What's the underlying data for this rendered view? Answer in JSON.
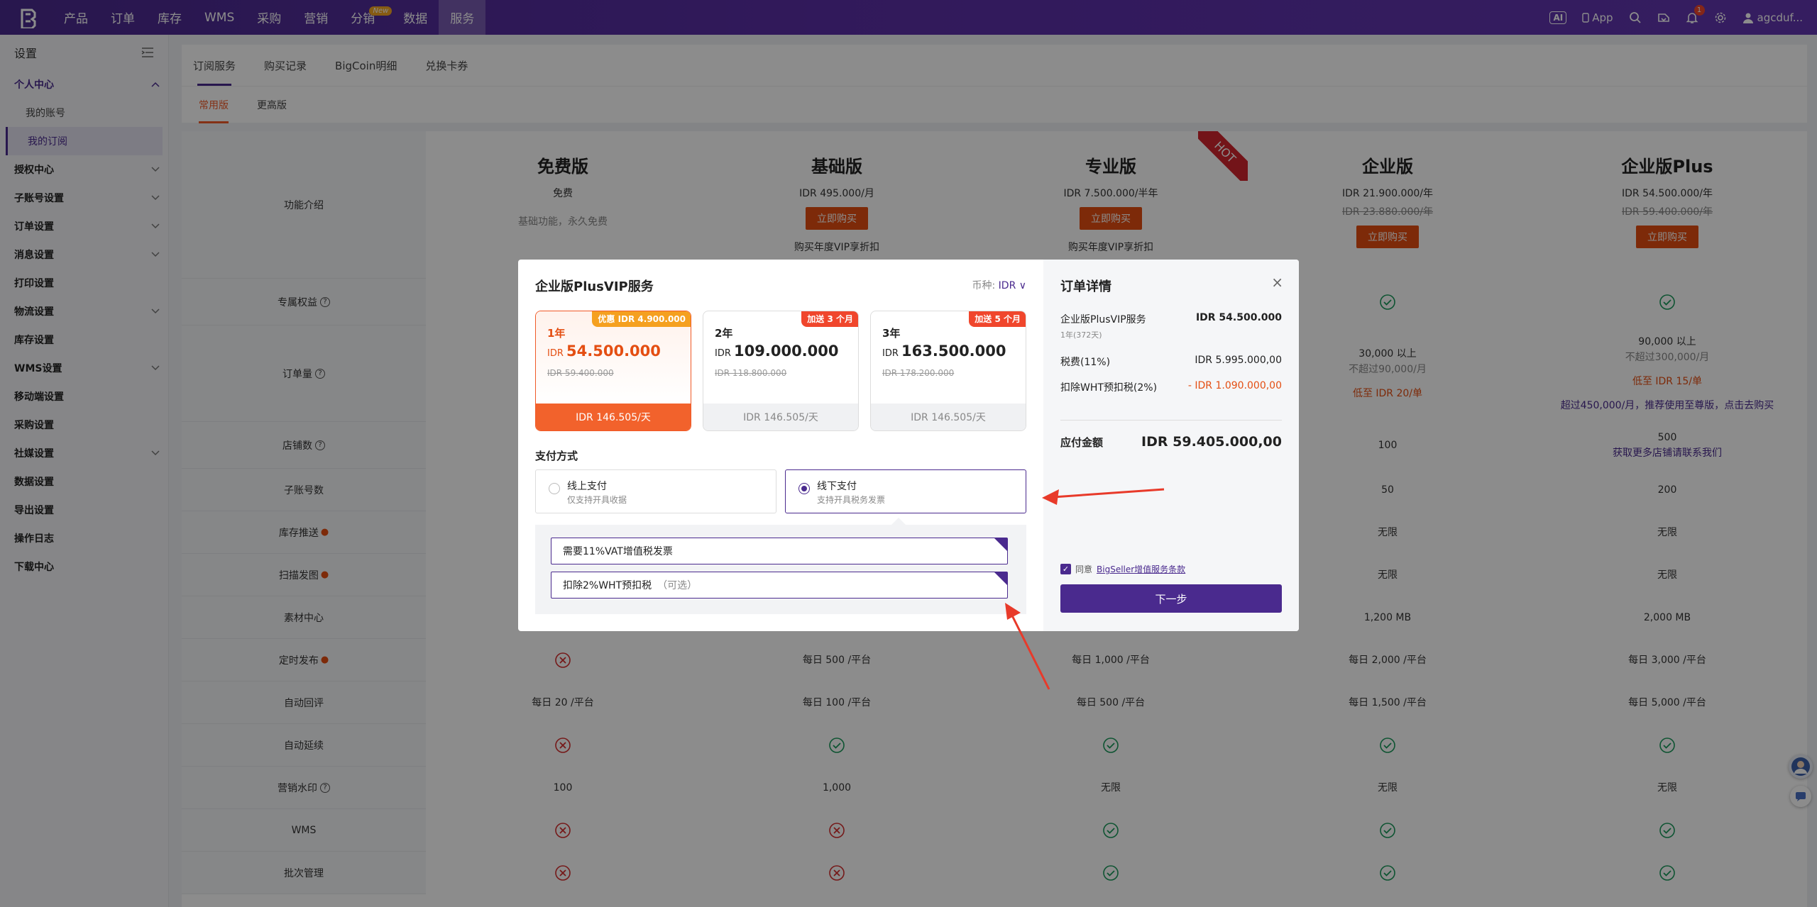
{
  "nav": {
    "items": [
      "产品",
      "订单",
      "库存",
      "WMS",
      "采购",
      "营销",
      "分销",
      "数据",
      "服务"
    ],
    "new_badge": "New",
    "ai": "AI",
    "app": "App",
    "notify_count": "1",
    "user": "agcduf..."
  },
  "sidebar": {
    "title": "设置",
    "groups": [
      {
        "label": "个人中心",
        "open": true
      },
      {
        "label": "授权中心"
      },
      {
        "label": "子账号设置"
      },
      {
        "label": "订单设置"
      },
      {
        "label": "消息设置"
      },
      {
        "label": "打印设置"
      },
      {
        "label": "物流设置"
      },
      {
        "label": "库存设置"
      },
      {
        "label": "WMS设置"
      },
      {
        "label": "移动端设置"
      },
      {
        "label": "采购设置"
      },
      {
        "label": "社媒设置"
      },
      {
        "label": "数据设置"
      },
      {
        "label": "导出设置"
      },
      {
        "label": "操作日志"
      },
      {
        "label": "下载中心"
      }
    ],
    "sub": [
      "我的账号",
      "我的订阅"
    ]
  },
  "tabs": [
    "订阅服务",
    "购买记录",
    "BigCoin明细",
    "兑换卡券"
  ],
  "subtabs": [
    "常用版",
    "更高版"
  ],
  "plans": [
    {
      "name": "免费版",
      "price": "免费",
      "desc": "基础功能，永久免费"
    },
    {
      "name": "基础版",
      "price": "IDR 495.000/月",
      "buy": "立即购买",
      "vip": "购买年度VIP享折扣"
    },
    {
      "name": "专业版",
      "price": "IDR 7.500.000/半年",
      "buy": "立即购买",
      "vip": "购买年度VIP享折扣",
      "hot": "HOT"
    },
    {
      "name": "企业版",
      "price": "IDR 21.900.000/年",
      "orig": "IDR 23.880.000/年",
      "buy": "立即购买"
    },
    {
      "name": "企业版Plus",
      "price": "IDR 54.500.000/年",
      "orig": "IDR 59.400.000/年",
      "buy": "立即购买"
    }
  ],
  "features": {
    "intro": "功能介绍",
    "exclusive": "专属权益",
    "orders": "订单量",
    "shops": "店铺数",
    "subaccounts": "子账号数",
    "stock_push": "库存推送",
    "scan_ship": "扫描发图",
    "material": "素材中心",
    "schedule": "定时发布",
    "auto_reply": "自动回评",
    "auto_extend": "自动延续",
    "watermark": "营销水印",
    "wms": "WMS",
    "batch": "批次管理"
  },
  "rows": {
    "orders_ent": [
      "30,000 以上",
      "不超过90,000/月",
      "低至 IDR 20/单"
    ],
    "orders_plus": [
      "90,000 以上",
      "不超过300,000/月",
      "低至 IDR 15/单",
      "超过450,000/月，推荐使用至尊版，点击去购买"
    ],
    "shops_ent": "100",
    "shops_plus": "500",
    "shops_plus_link": "获取更多店铺请联系我们",
    "sub_ent": "50",
    "sub_plus": "200",
    "unlimited": "无限",
    "material_ent": "1,200 MB",
    "material_plus": "2,000 MB",
    "schedule": [
      "每日 500 /平台",
      "每日 1,000 /平台",
      "每日 2,000 /平台",
      "每日 3,000 /平台"
    ],
    "reply": [
      "每日 20 /平台",
      "每日 100 /平台",
      "每日 500 /平台",
      "每日 1,500 /平台",
      "每日 5,000 /平台"
    ],
    "watermark": [
      "100",
      "1,000",
      "无限",
      "无限",
      "无限"
    ]
  },
  "modal": {
    "title": "企业版PlusVIP服务",
    "currency_label": "币种:",
    "currency": "IDR",
    "options": [
      {
        "years": "1年",
        "cur": "IDR",
        "amount": "54.500.000",
        "old": "IDR 59.400.000",
        "perday": "IDR 146.505/天",
        "ribbon": "优惠 IDR 4.900.000"
      },
      {
        "years": "2年",
        "cur": "IDR",
        "amount": "109.000.000",
        "old": "IDR 118.800.000",
        "perday": "IDR 146.505/天",
        "ribbon": "加送 3 个月"
      },
      {
        "years": "3年",
        "cur": "IDR",
        "amount": "163.500.000",
        "old": "IDR 178.200.000",
        "perday": "IDR 146.505/天",
        "ribbon": "加送 5 个月"
      }
    ],
    "pay_label": "支付方式",
    "pay_online": "线上支付",
    "pay_online_sub": "仅支持开具收据",
    "pay_offline": "线下支付",
    "pay_offline_sub": "支持开具税务发票",
    "vat": "需要11%VAT增值税发票",
    "wht": "扣除2%WHT预扣税",
    "optional": "（可选）"
  },
  "order": {
    "title": "订单详情",
    "item": "企业版PlusVIP服务",
    "item_price": "IDR 54.500.000",
    "item_sub": "1年(372天)",
    "tax": "税费(11%)",
    "tax_value": "IDR 5.995.000,00",
    "wht": "扣除WHT预扣税(2%)",
    "wht_value": "- IDR 1.090.000,00",
    "total_label": "应付金额",
    "total": "IDR 59.405.000,00",
    "agree": "同意",
    "terms": "BigSeller增值服务条款",
    "next": "下一步"
  }
}
